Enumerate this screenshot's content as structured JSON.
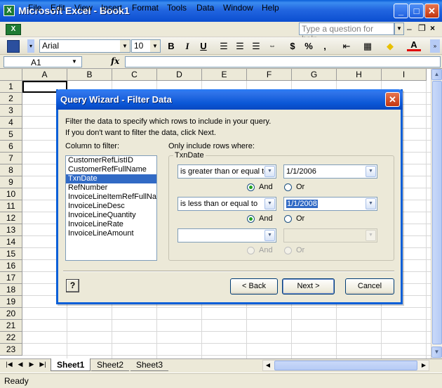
{
  "window": {
    "title": "Microsoft Excel - Book1",
    "minimize": "_",
    "maximize": "□",
    "close": "✕"
  },
  "menu": [
    "File",
    "Edit",
    "View",
    "Insert",
    "Format",
    "Tools",
    "Data",
    "Window",
    "Help"
  ],
  "menu_accel": [
    "F",
    "E",
    "V",
    "I",
    "o",
    "T",
    "D",
    "W",
    "H"
  ],
  "help_box": {
    "placeholder": "Type a question for help"
  },
  "toolbar": {
    "font": "Arial",
    "size": "10",
    "bold": "B",
    "italic": "I",
    "underline": "U",
    "currency": "$",
    "percent": "%",
    "comma": ","
  },
  "formula_bar": {
    "name_box": "A1",
    "fx": "fx",
    "content": ""
  },
  "columns": [
    "A",
    "B",
    "C",
    "D",
    "E",
    "F",
    "G",
    "H",
    "I"
  ],
  "rows": [
    "1",
    "2",
    "3",
    "4",
    "5",
    "6",
    "7",
    "8",
    "9",
    "10",
    "11",
    "12",
    "13",
    "14",
    "15",
    "16",
    "17",
    "18",
    "19",
    "20",
    "21",
    "22",
    "23"
  ],
  "sheets": [
    "Sheet1",
    "Sheet2",
    "Sheet3"
  ],
  "status": "Ready",
  "dialog": {
    "title": "Query Wizard - Filter Data",
    "instruction_1": "Filter the data to specify which rows to include in your query.",
    "instruction_2": "If you don't want to filter the data, click Next.",
    "column_label": "Column to filter:",
    "column_accel": "C",
    "rows_label": "Only include rows where:",
    "group_title": "TxnDate",
    "columns": [
      "CustomerRefListID",
      "CustomerRefFullName",
      "TxnDate",
      "RefNumber",
      "InvoiceLineItemRefFullNar",
      "InvoiceLineDesc",
      "InvoiceLineQuantity",
      "InvoiceLineRate",
      "InvoiceLineAmount"
    ],
    "selected_column": "TxnDate",
    "conditions": [
      {
        "operator": "is greater than or equal to",
        "value": "1/1/2006",
        "and": "And",
        "or": "Or",
        "selected": "And"
      },
      {
        "operator": "is less than or equal to",
        "value": "1/1/2008",
        "and": "And",
        "or": "Or",
        "selected": "And"
      },
      {
        "operator": "",
        "value": "",
        "and": "And",
        "or": "Or",
        "selected": "And"
      }
    ],
    "buttons": {
      "help": "?",
      "back": "< Back",
      "next": "Next >",
      "cancel": "Cancel"
    }
  }
}
